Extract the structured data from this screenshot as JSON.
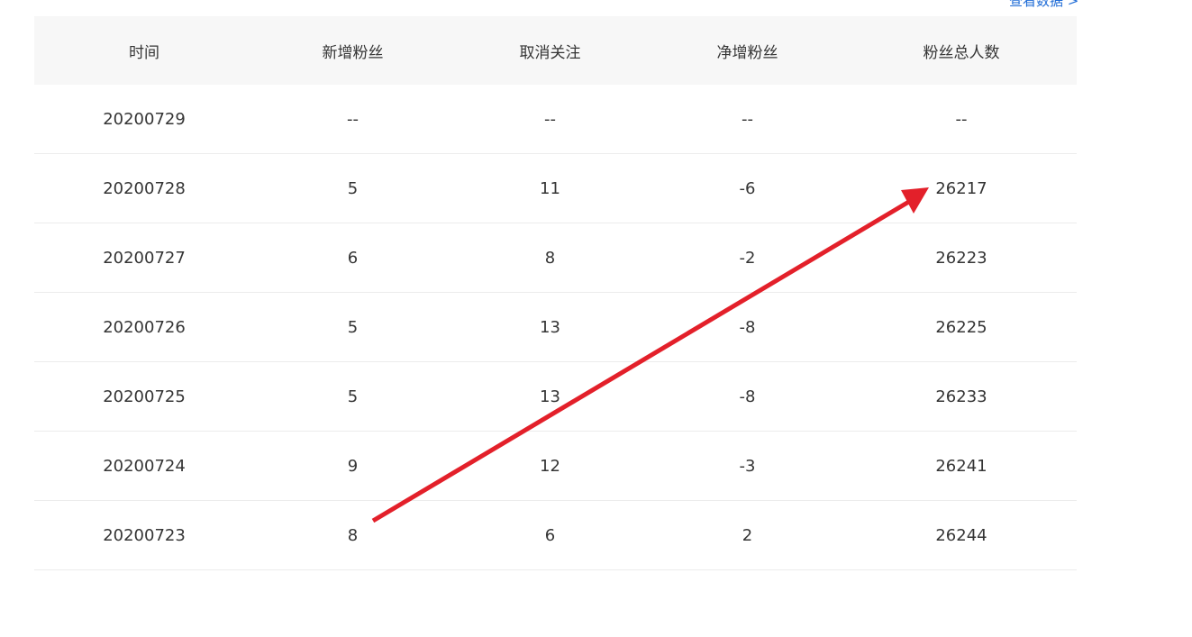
{
  "top_link": "查看数据 >",
  "table": {
    "headers": [
      "时间",
      "新增粉丝",
      "取消关注",
      "净增粉丝",
      "粉丝总人数"
    ],
    "rows": [
      [
        "20200729",
        "--",
        "--",
        "--",
        "--"
      ],
      [
        "20200728",
        "5",
        "11",
        "-6",
        "26217"
      ],
      [
        "20200727",
        "6",
        "8",
        "-2",
        "26223"
      ],
      [
        "20200726",
        "5",
        "13",
        "-8",
        "26225"
      ],
      [
        "20200725",
        "5",
        "13",
        "-8",
        "26233"
      ],
      [
        "20200724",
        "9",
        "12",
        "-3",
        "26241"
      ],
      [
        "20200723",
        "8",
        "6",
        "2",
        "26244"
      ]
    ]
  },
  "colors": {
    "annotation_arrow": "#e3202a",
    "header_background": "#f7f7f7",
    "link": "#1e6bd6"
  }
}
